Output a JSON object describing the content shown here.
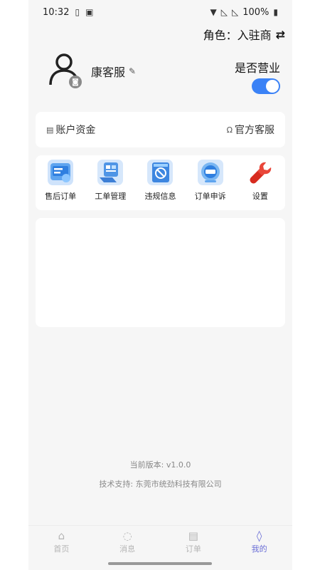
{
  "status": {
    "time": "10:32",
    "battery": "100%"
  },
  "role": {
    "label": "角色：入驻商",
    "switch_icon": "swap-icon"
  },
  "profile": {
    "name": "康客服",
    "business_label": "是否营业",
    "business_open": true
  },
  "account": {
    "funds_label": "账户资金",
    "service_label": "官方客服"
  },
  "functions": [
    {
      "label": "售后订单",
      "icon": "after-sale-icon"
    },
    {
      "label": "工单管理",
      "icon": "work-order-icon"
    },
    {
      "label": "违规信息",
      "icon": "violation-icon"
    },
    {
      "label": "订单申诉",
      "icon": "appeal-icon"
    },
    {
      "label": "设置",
      "icon": "wrench-icon"
    }
  ],
  "footer": {
    "version": "当前版本: v1.0.0",
    "support": "技术支持: 东莞市统劲科技有限公司"
  },
  "tabs": [
    {
      "label": "首页",
      "icon": "store-icon",
      "active": false
    },
    {
      "label": "消息",
      "icon": "message-icon",
      "active": false
    },
    {
      "label": "订单",
      "icon": "order-icon",
      "active": false
    },
    {
      "label": "我的",
      "icon": "profile-icon",
      "active": true
    }
  ],
  "colors": {
    "accent": "#3b82f6",
    "tab_active": "#6a6ed6",
    "background": "#f6f6f6"
  }
}
